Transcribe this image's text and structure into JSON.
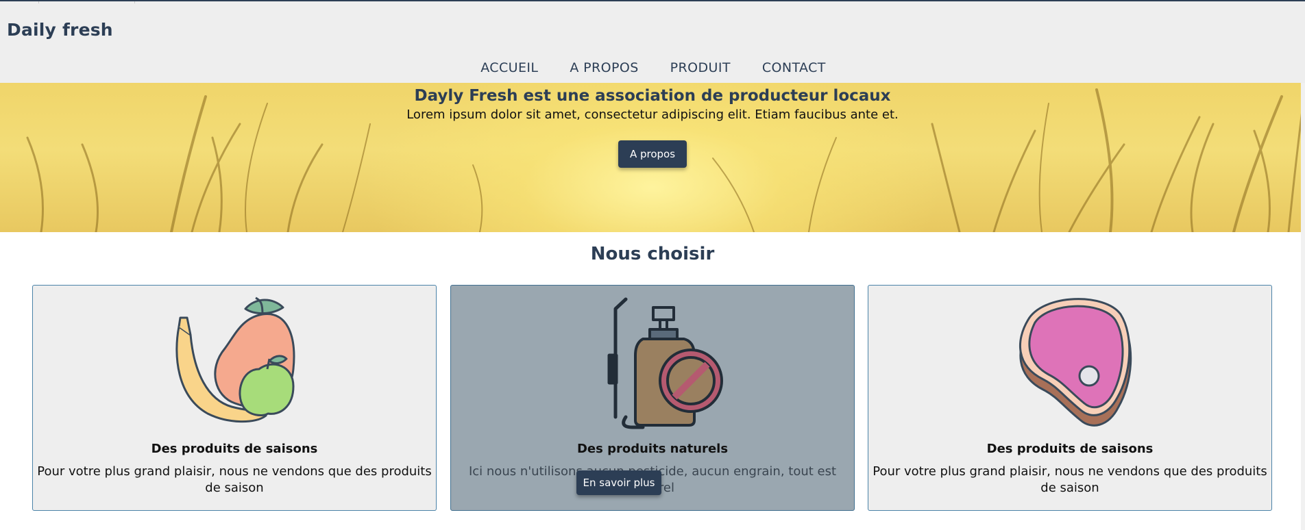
{
  "header": {
    "logo": "Daily fresh",
    "nav": [
      "ACCUEIL",
      "A PROPOS",
      "PRODUIT",
      "CONTACT"
    ]
  },
  "hero": {
    "title": "Dayly Fresh est une association de producteur locaux",
    "subtitle": "Lorem ipsum dolor sit amet, consectetur adipiscing elit. Etiam faucibus ante et.",
    "button_label": "A propos"
  },
  "section": {
    "title": "Nous choisir"
  },
  "cards": [
    {
      "icon": "fruits-icon",
      "title": "Des produits de saisons",
      "text": "Pour votre plus grand plaisir, nous ne vendons que des produits de saison"
    },
    {
      "icon": "no-pesticide-icon",
      "title": "Des produits naturels",
      "text": "Ici nous n'utilisons aucun pesticide, aucun engrain, tout est naturel",
      "button_label": "En savoir plus"
    },
    {
      "icon": "meat-steak-icon",
      "title": "Des produits de saisons",
      "text": "Pour votre plus grand plaisir, nous ne vendons que des produits de saison"
    }
  ],
  "colors": {
    "primary": "#2c3e55",
    "header_bg": "#eeeeee",
    "card_border": "#4a82a8",
    "card_hover_bg": "#9aa7b0"
  }
}
